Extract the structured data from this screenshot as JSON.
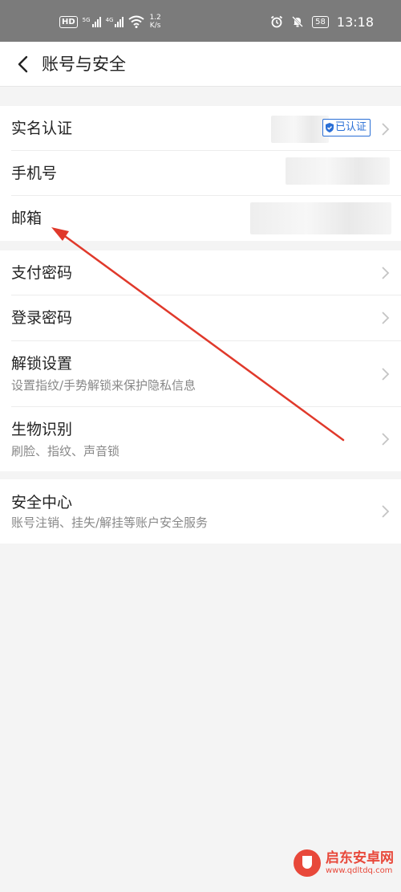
{
  "status_bar": {
    "hd_label": "HD",
    "sim1_tag": "5G",
    "sim2_tag": "4G",
    "speed_value": "1.2",
    "speed_unit": "K/s",
    "battery": "58",
    "time": "13:18"
  },
  "header": {
    "title": "账号与安全"
  },
  "group1": {
    "items": [
      {
        "label": "实名认证",
        "badge": "已认证"
      },
      {
        "label": "手机号"
      },
      {
        "label": "邮箱"
      }
    ]
  },
  "group2": {
    "items": [
      {
        "label": "支付密码"
      },
      {
        "label": "登录密码"
      },
      {
        "label": "解锁设置",
        "sub": "设置指纹/手势解锁来保护隐私信息"
      },
      {
        "label": "生物识别",
        "sub": "刷脸、指纹、声音锁"
      }
    ]
  },
  "group3": {
    "items": [
      {
        "label": "安全中心",
        "sub": "账号注销、挂失/解挂等账户安全服务"
      }
    ]
  },
  "annotation": {
    "color": "#e0392b"
  },
  "watermark": {
    "name": "启东安卓网",
    "url": "www.qdltdq.com",
    "color": "#e8483a"
  },
  "colors": {
    "accent": "#2a6fd6",
    "text": "#222222",
    "subtext": "#888888",
    "background": "#f4f4f4"
  }
}
